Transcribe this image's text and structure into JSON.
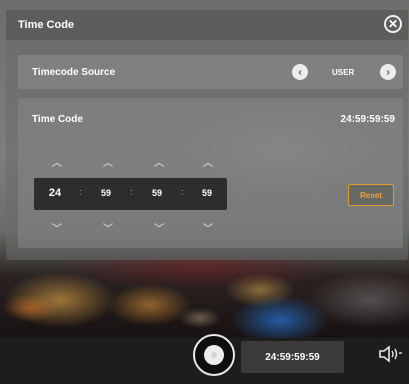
{
  "dialog": {
    "title": "Time Code",
    "close_icon": "close-icon"
  },
  "source": {
    "label": "Timecode Source",
    "value": "USER",
    "prev_icon": "chevron-left-icon",
    "next_icon": "chevron-right-icon"
  },
  "timecode": {
    "label": "Time Code",
    "current": "24:59:59:59",
    "fields": [
      "24",
      "59",
      "59",
      "59"
    ],
    "separator": ":",
    "up_icon": "chevron-up-icon",
    "down_icon": "chevron-down-icon",
    "reset_label": "Reset"
  },
  "bottom": {
    "timecode": "24:59:59:59",
    "record_icon": "record-icon",
    "speaker_icon": "speaker-icon"
  },
  "colors": {
    "accent": "#e39b2b"
  }
}
